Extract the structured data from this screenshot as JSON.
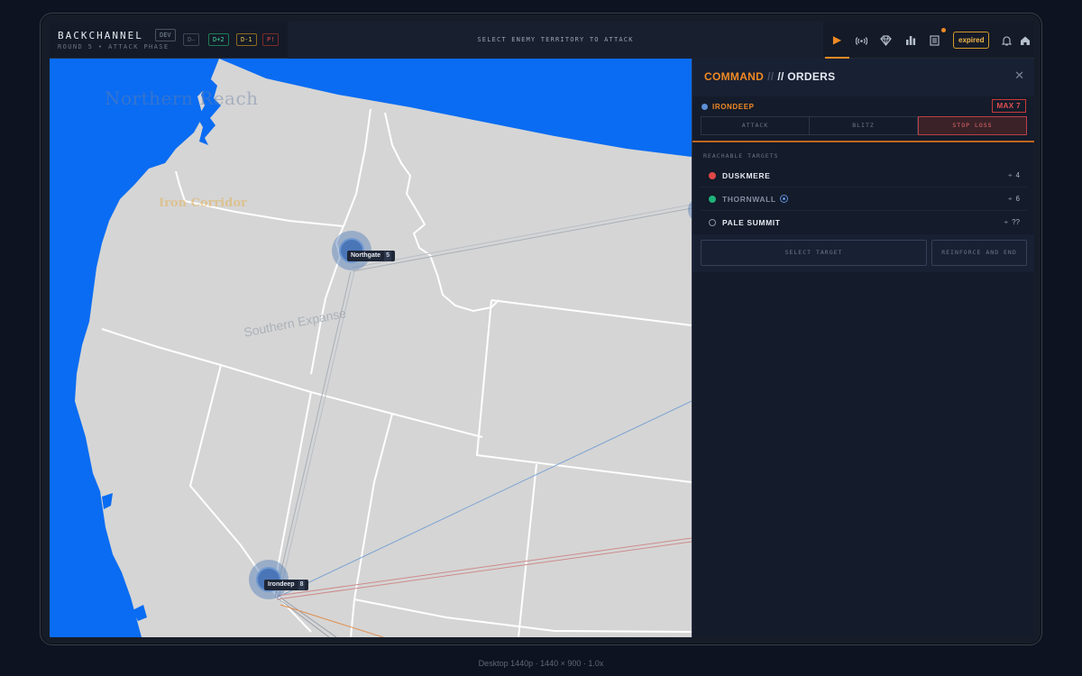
{
  "app": {
    "title": "BACKCHANNEL",
    "subtitle": "ROUND 5 • ATTACK PHASE",
    "env_badge": "DEV",
    "chips": [
      "D—",
      "D+2",
      "D-1",
      "P!"
    ]
  },
  "instruction": "SELECT ENEMY TERRITORY TO ATTACK",
  "toolbar": {
    "icons": [
      "play-icon",
      "signal-icon",
      "diamond-icon",
      "bar-chart-icon",
      "ledger-icon",
      "bell-icon",
      "home-icon"
    ],
    "expired_label": "expired",
    "accent": "#f08a24"
  },
  "map": {
    "region_labels": {
      "north": "Northern Reach",
      "iron": "Iron Corridor",
      "south": "Southern Expanse"
    },
    "nodes": [
      {
        "name": "Northgate",
        "troops": "5"
      },
      {
        "name": "Irondeep",
        "troops": "8"
      }
    ]
  },
  "panel": {
    "title_primary": "COMMAND",
    "title_sep": "//",
    "title_secondary": "// ORDERS",
    "close_icon": "close-icon",
    "source": "IRONDEEP",
    "max_badge": "MAX 7",
    "modes": [
      "ATTACK",
      "BLITZ",
      "STOP LOSS"
    ],
    "selected_mode": "STOP LOSS",
    "reachable_heading": "REACHABLE TARGETS",
    "targets": [
      {
        "name": "DUSKMERE",
        "color": "#e04848",
        "troops": "4",
        "dim": false
      },
      {
        "name": "THORNWALL",
        "color": "#1fb27a",
        "troops": "6",
        "dim": true
      },
      {
        "name": "PALE SUMMIT",
        "color": "",
        "troops": "??",
        "dim": false
      }
    ],
    "select_target_label": "SELECT TARGET",
    "reinforce_label": "REINFORCE AND END"
  },
  "caption": "Desktop 1440p  ·  1440 × 900 · 1.0x"
}
